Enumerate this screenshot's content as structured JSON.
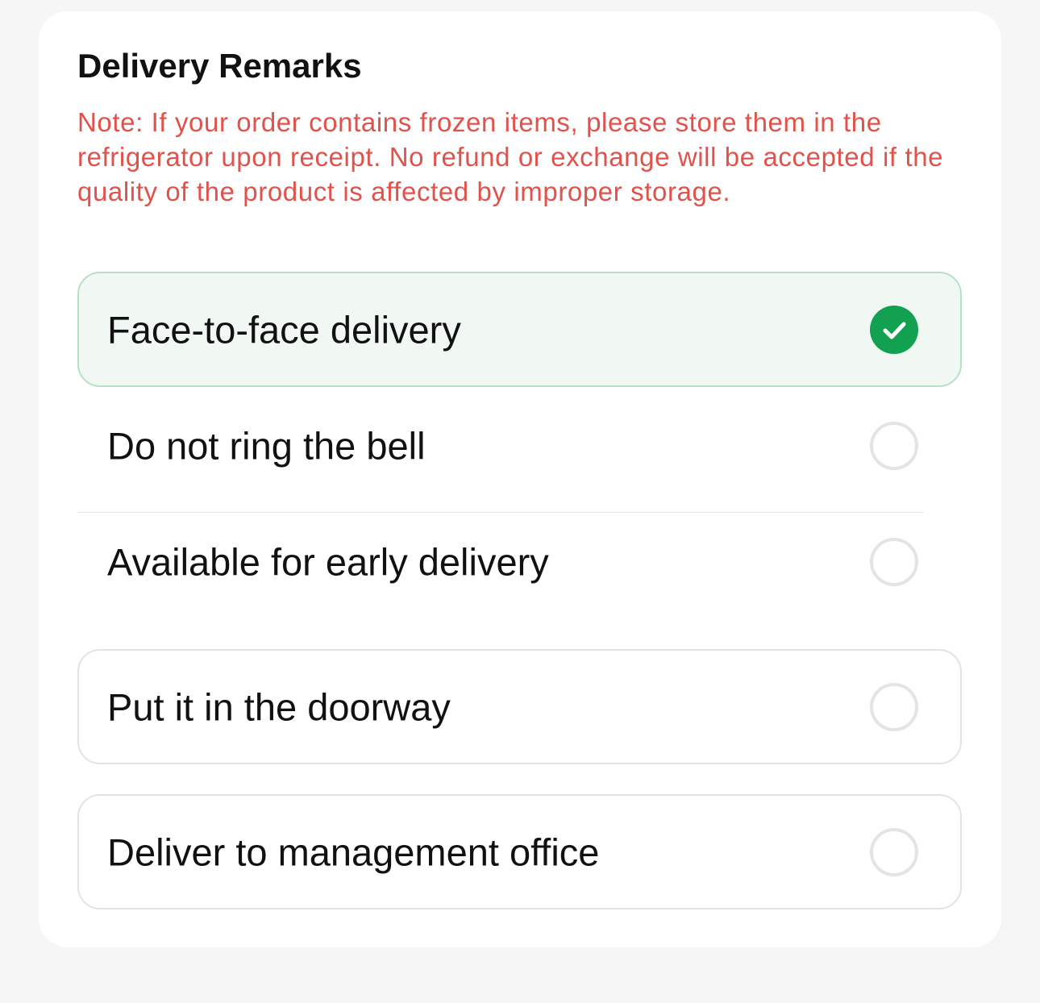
{
  "remarks": {
    "title": "Delivery Remarks",
    "note": "Note: If your order contains frozen items, please store them in the refrigerator upon receipt. No refund or exchange will be accepted if the quality of the product is affected by improper storage.",
    "options": [
      {
        "label": "Face-to-face delivery",
        "selected": true
      },
      {
        "label": "Do not ring the bell",
        "selected": false
      },
      {
        "label": "Available for early delivery",
        "selected": false
      },
      {
        "label": "Put it in the doorway",
        "selected": false
      },
      {
        "label": "Deliver to management office",
        "selected": false
      }
    ]
  },
  "colors": {
    "note_text": "#e0524a",
    "selected_background": "#f1f8f4",
    "selected_border": "#b5e2c5",
    "check_green": "#12a150"
  },
  "icons": {
    "selected": "check-circle-icon",
    "unselected": "radio-circle-icon"
  }
}
